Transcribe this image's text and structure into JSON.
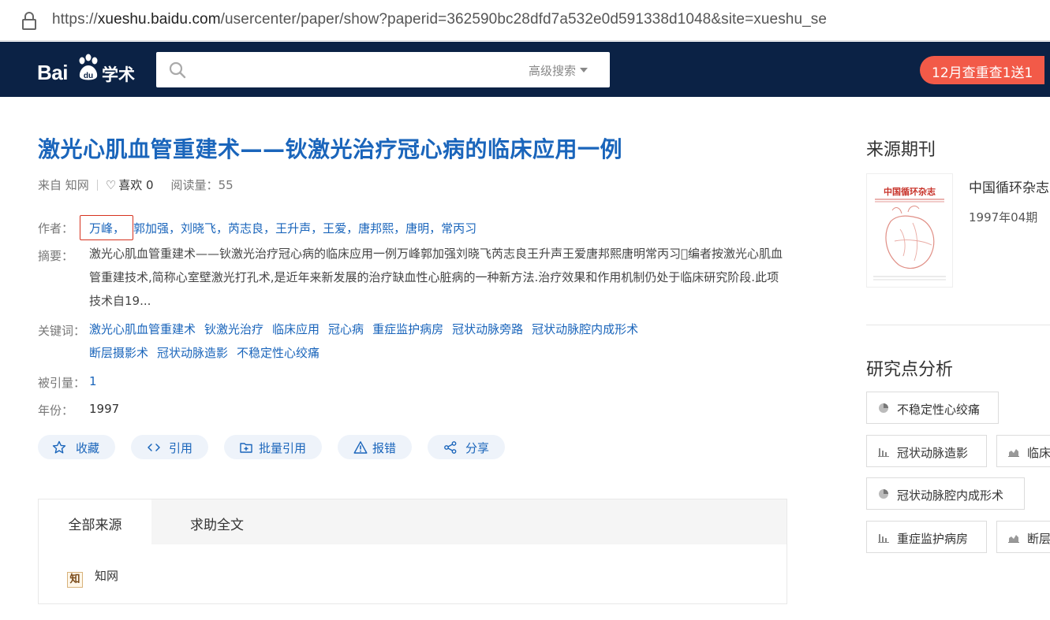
{
  "browser": {
    "url_scheme": "https://",
    "url_host": "xueshu.baidu.com",
    "url_path": "/usercenter/paper/show?paperid=362590bc28dfd7a532e0d591338d1048&site=xueshu_se"
  },
  "header": {
    "logo_bai": "Bai",
    "logo_du": "du",
    "logo_xueshu": "学术",
    "search_value": "",
    "advanced_search_label": "高级搜索",
    "promo_label": "12月查重查1送1"
  },
  "paper": {
    "title": "激光心肌血管重建术——钬激光治疗冠心病的临床应用一例",
    "source_label": "来自 知网",
    "like_label": "喜欢 0",
    "reads_label": "阅读量：",
    "reads_value": "55",
    "authors_label": "作者：",
    "authors": [
      "万峰，",
      "郭加强，",
      "刘晓飞，",
      "芮志良，",
      "王升声，",
      "王爱，",
      "唐邦熙，",
      "唐明，",
      "常丙习"
    ],
    "abstract_label": "摘要：",
    "abstract": "激光心肌血管重建术——钬激光治疗冠心病的临床应用一例万峰郭加强刘晓飞芮志良王升声王爱唐邦熙唐明常丙习\u0000编者按激光心肌血管重建技术,简称心室壁激光打孔术,是近年来新发展的治疗缺血性心脏病的一种新方法.治疗效果和作用机制仍处于临床研究阶段.此项技术自19...",
    "keywords_label": "关键词：",
    "keywords": [
      "激光心肌血管重建术",
      "钬激光治疗",
      "临床应用",
      "冠心病",
      "重症监护病房",
      "冠状动脉旁路",
      "冠状动脉腔内成形术",
      "断层摄影术",
      "冠状动脉造影",
      "不稳定性心绞痛"
    ],
    "cited_label": "被引量：",
    "cited_value": "1",
    "year_label": "年份：",
    "year_value": "1997"
  },
  "actions": {
    "collect": "收藏",
    "cite": "引用",
    "batch_cite": "批量引用",
    "report": "报错",
    "share": "分享"
  },
  "sources": {
    "tabs": [
      "全部来源",
      "求助全文"
    ],
    "active_tab": 0,
    "items": [
      {
        "icon_text": "知",
        "name": "知网"
      }
    ]
  },
  "sidebar": {
    "journal_heading": "来源期刊",
    "journal_name": "中国循环杂志",
    "journal_date": "1997年04期",
    "analysis_heading": "研究点分析",
    "topics": [
      {
        "label": "不稳定性心绞痛",
        "icon": "pie-chart-icon"
      },
      {
        "label": "冠状动脉造影",
        "icon": "bar-chart-icon"
      },
      {
        "label": "临床",
        "icon": "area-chart-icon"
      },
      {
        "label": "冠状动脉腔内成形术",
        "icon": "pie-chart-icon"
      },
      {
        "label": "重症监护病房",
        "icon": "bar-chart-icon"
      },
      {
        "label": "断层",
        "icon": "area-chart-icon"
      }
    ]
  },
  "colors": {
    "header_bg": "#0b2245",
    "link_blue": "#1a65bb",
    "promo_red": "#f25a48",
    "author_highlight": "#d6321f"
  }
}
